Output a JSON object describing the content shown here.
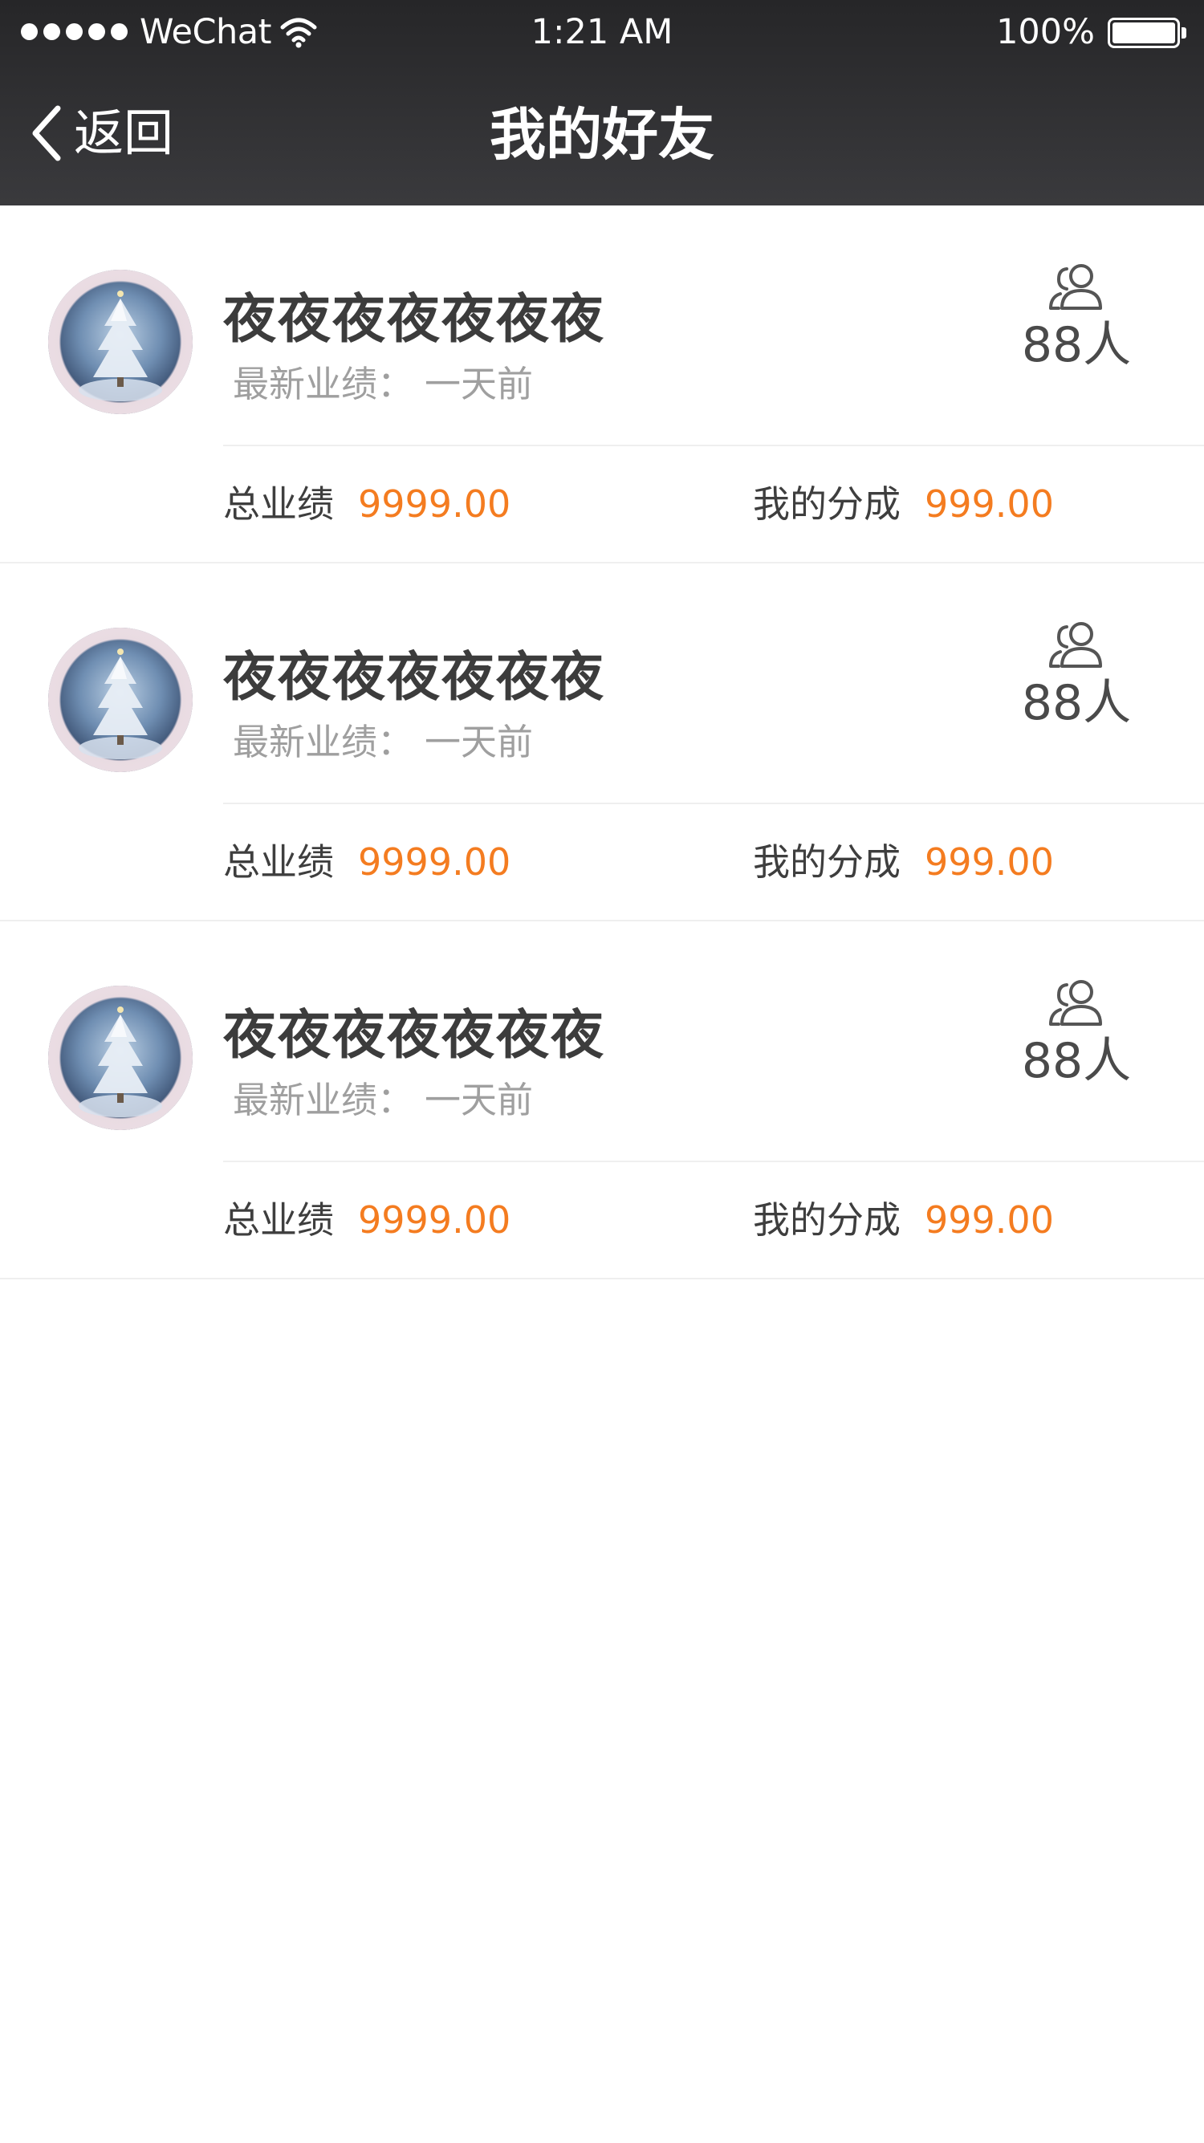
{
  "status_bar": {
    "carrier": "WeChat",
    "time": "1:21 AM",
    "battery_percent": "100%",
    "signal_bars": 5,
    "icons": [
      "signal-dots-icon",
      "wifi-icon",
      "battery-icon"
    ]
  },
  "nav": {
    "back_label": "返回",
    "title": "我的好友",
    "back_icon": "chevron-left-icon"
  },
  "colors": {
    "header_bg": "#2f2f31",
    "accent": "#f47c20",
    "primary_text": "#3c3c3c",
    "secondary_text": "#9f9f9f"
  },
  "friends": [
    {
      "name": "夜夜夜夜夜夜夜",
      "latest_label": "最新业绩：",
      "latest_value": "一天前",
      "count": "88人",
      "total_label": "总业绩",
      "total_value": "9999.00",
      "share_label": "我的分成",
      "share_value": "999.00"
    },
    {
      "name": "夜夜夜夜夜夜夜",
      "latest_label": "最新业绩：",
      "latest_value": "一天前",
      "count": "88人",
      "total_label": "总业绩",
      "total_value": "9999.00",
      "share_label": "我的分成",
      "share_value": "999.00"
    },
    {
      "name": "夜夜夜夜夜夜夜",
      "latest_label": "最新业绩：",
      "latest_value": "一天前",
      "count": "88人",
      "total_label": "总业绩",
      "total_value": "9999.00",
      "share_label": "我的分成",
      "share_value": "999.00"
    }
  ]
}
